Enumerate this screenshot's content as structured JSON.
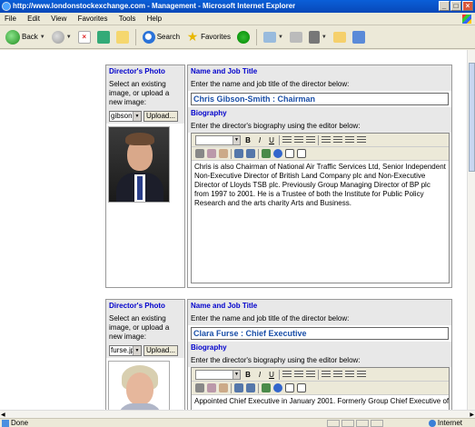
{
  "window": {
    "title": "http://www.londonstockexchange.com - Management - Microsoft Internet Explorer",
    "controls": [
      "_",
      "□",
      "×"
    ]
  },
  "menu": [
    "File",
    "Edit",
    "View",
    "Favorites",
    "Tools",
    "Help"
  ],
  "toolbar": {
    "back_label": "Back",
    "search_label": "Search",
    "favorites_label": "Favorites"
  },
  "blocks": [
    {
      "photo_header": "Director's Photo",
      "photo_instructions": "Select an existing image, or upload a new image:",
      "photo_select_value": "gibson",
      "upload_label": "Upload...",
      "name_header": "Name and Job Title",
      "name_instructions": "Enter the name and job title of the director below:",
      "name_value": "Chris Gibson-Smith : Chairman",
      "bio_header": "Biography",
      "bio_instructions": "Enter the director's biography using the editor below:",
      "bio_text": "Chris is also Chairman of National Air Traffic Services Ltd, Senior Independent Non-Executive Director of British Land Company plc and Non-Executive Director of Lloyds TSB plc. Previously Group Managing Director of BP plc from 1997 to 2001. He is a Trustee of both the Institute for Public Policy Research and the arts charity Arts and Business."
    },
    {
      "photo_header": "Director's Photo",
      "photo_instructions": "Select an existing image, or upload a new image:",
      "photo_select_value": "furse.jp",
      "upload_label": "Upload...",
      "name_header": "Name and Job Title",
      "name_instructions": "Enter the name and job title of the director below:",
      "name_value": "Clara Furse : Chief Executive",
      "bio_header": "Biography",
      "bio_instructions": "Enter the director's biography using the editor below:",
      "bio_text": "Appointed Chief Executive in January 2001. Formerly Group Chief Executive of"
    }
  ],
  "status": {
    "text": "Done",
    "zone": "Internet"
  }
}
